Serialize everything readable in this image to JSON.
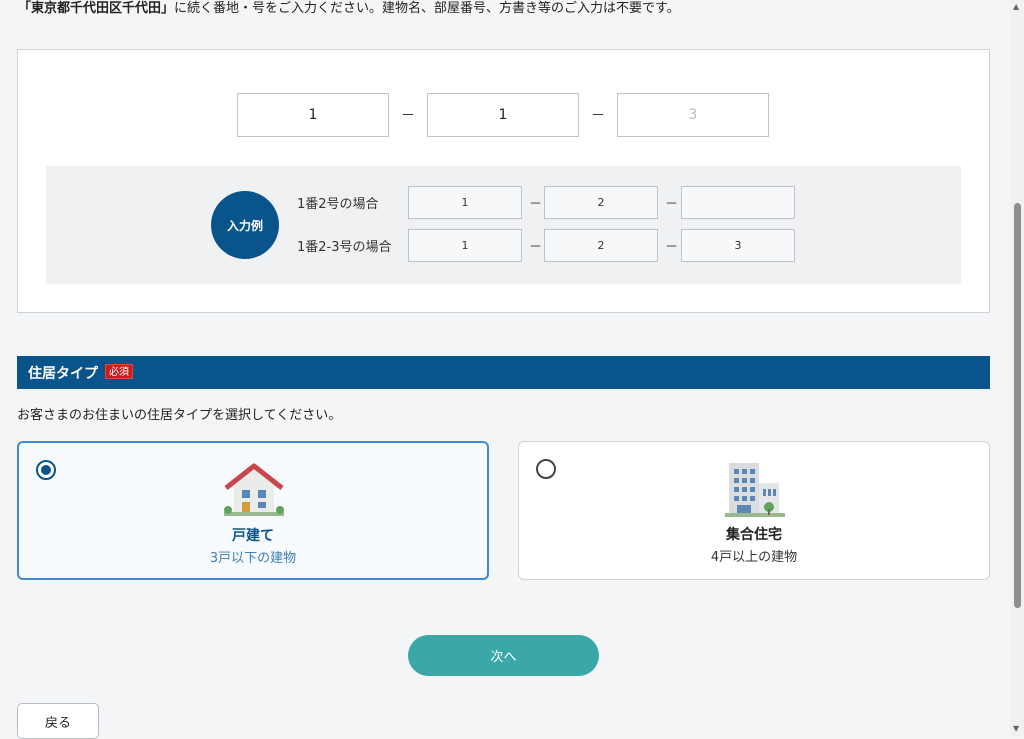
{
  "instruction": {
    "address_bold": "「東京都千代田区千代田」",
    "text": "に続く番地・号をご入力ください。建物名、部屋番号、方書き等のご入力は不要です。"
  },
  "address_inputs": {
    "field1_value": "1",
    "field2_value": "1",
    "field3_placeholder": "3",
    "separator": "－"
  },
  "example": {
    "badge": "入力例",
    "rows": [
      {
        "label": "1番2号の場合",
        "values": [
          "1",
          "2",
          ""
        ]
      },
      {
        "label": "1番2-3号の場合",
        "values": [
          "1",
          "2",
          "3"
        ]
      }
    ]
  },
  "residence": {
    "title": "住居タイプ",
    "required": "必須",
    "description": "お客さまのお住まいの住居タイプを選択してください。",
    "options": [
      {
        "name": "戸建て",
        "sub": "3戸以下の建物",
        "icon": "house-icon",
        "selected": true
      },
      {
        "name": "集合住宅",
        "sub": "4戸以上の建物",
        "icon": "apartment-building-icon",
        "selected": false
      }
    ]
  },
  "buttons": {
    "next": "次へ",
    "back": "戻る"
  },
  "colors": {
    "primary": "#0a548c",
    "accent": "#3aa8a8",
    "required": "#c81e1e",
    "selected_border": "#3f8ad0"
  }
}
